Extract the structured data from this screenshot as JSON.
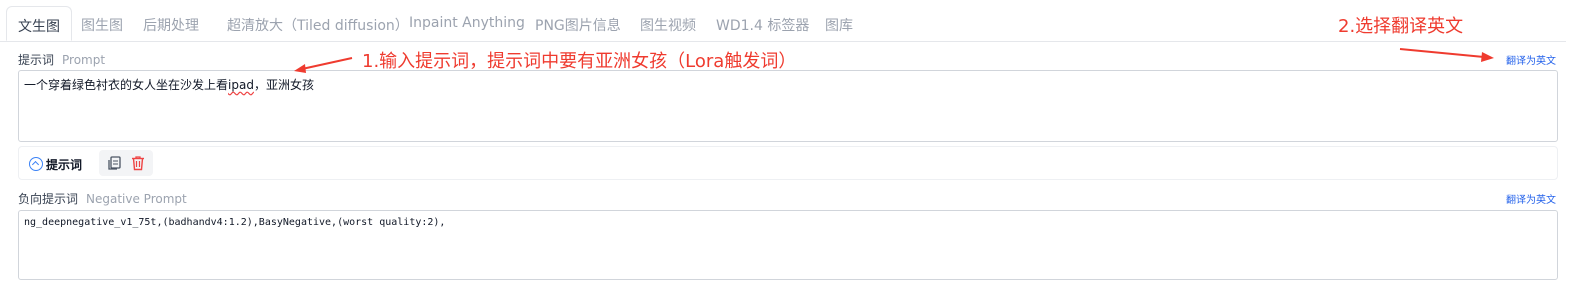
{
  "tabs": [
    {
      "label": "文生图",
      "active": true
    },
    {
      "label": "图生图",
      "active": false
    },
    {
      "label": "后期处理",
      "active": false
    },
    {
      "label": "超清放大（Tiled diffusion）",
      "active": false
    },
    {
      "label": "Inpaint Anything",
      "active": false
    },
    {
      "label": "PNG图片信息",
      "active": false
    },
    {
      "label": "图生视频",
      "active": false
    },
    {
      "label": "WD1.4 标签器",
      "active": false
    },
    {
      "label": "图库",
      "active": false
    }
  ],
  "prompt": {
    "label": "提示词",
    "label_en": "Prompt",
    "translate_link": "翻译为英文",
    "value_before": "一个穿着绿色衬衣的女人坐在沙发上看",
    "value_misspelled": "ipad",
    "value_after": "，亚洲女孩"
  },
  "toolbar": {
    "collapse_label": "提示词",
    "copy_icon": "copy-icon",
    "delete_icon": "trash-icon"
  },
  "negative_prompt": {
    "label": "负向提示词",
    "label_en": "Negative Prompt",
    "translate_link": "翻译为英文",
    "value": "ng_deepnegative_v1_75t,(badhandv4:1.2),BasyNegative,(worst quality:2),"
  },
  "annotations": {
    "step1": "1.输入提示词，提示词中要有亚洲女孩（Lora触发词）",
    "step2": "2.选择翻译英文"
  },
  "colors": {
    "annotation": "#ef3b2f",
    "link": "#2563eb",
    "accent": "#3b82f6",
    "delete": "#ef4444"
  }
}
